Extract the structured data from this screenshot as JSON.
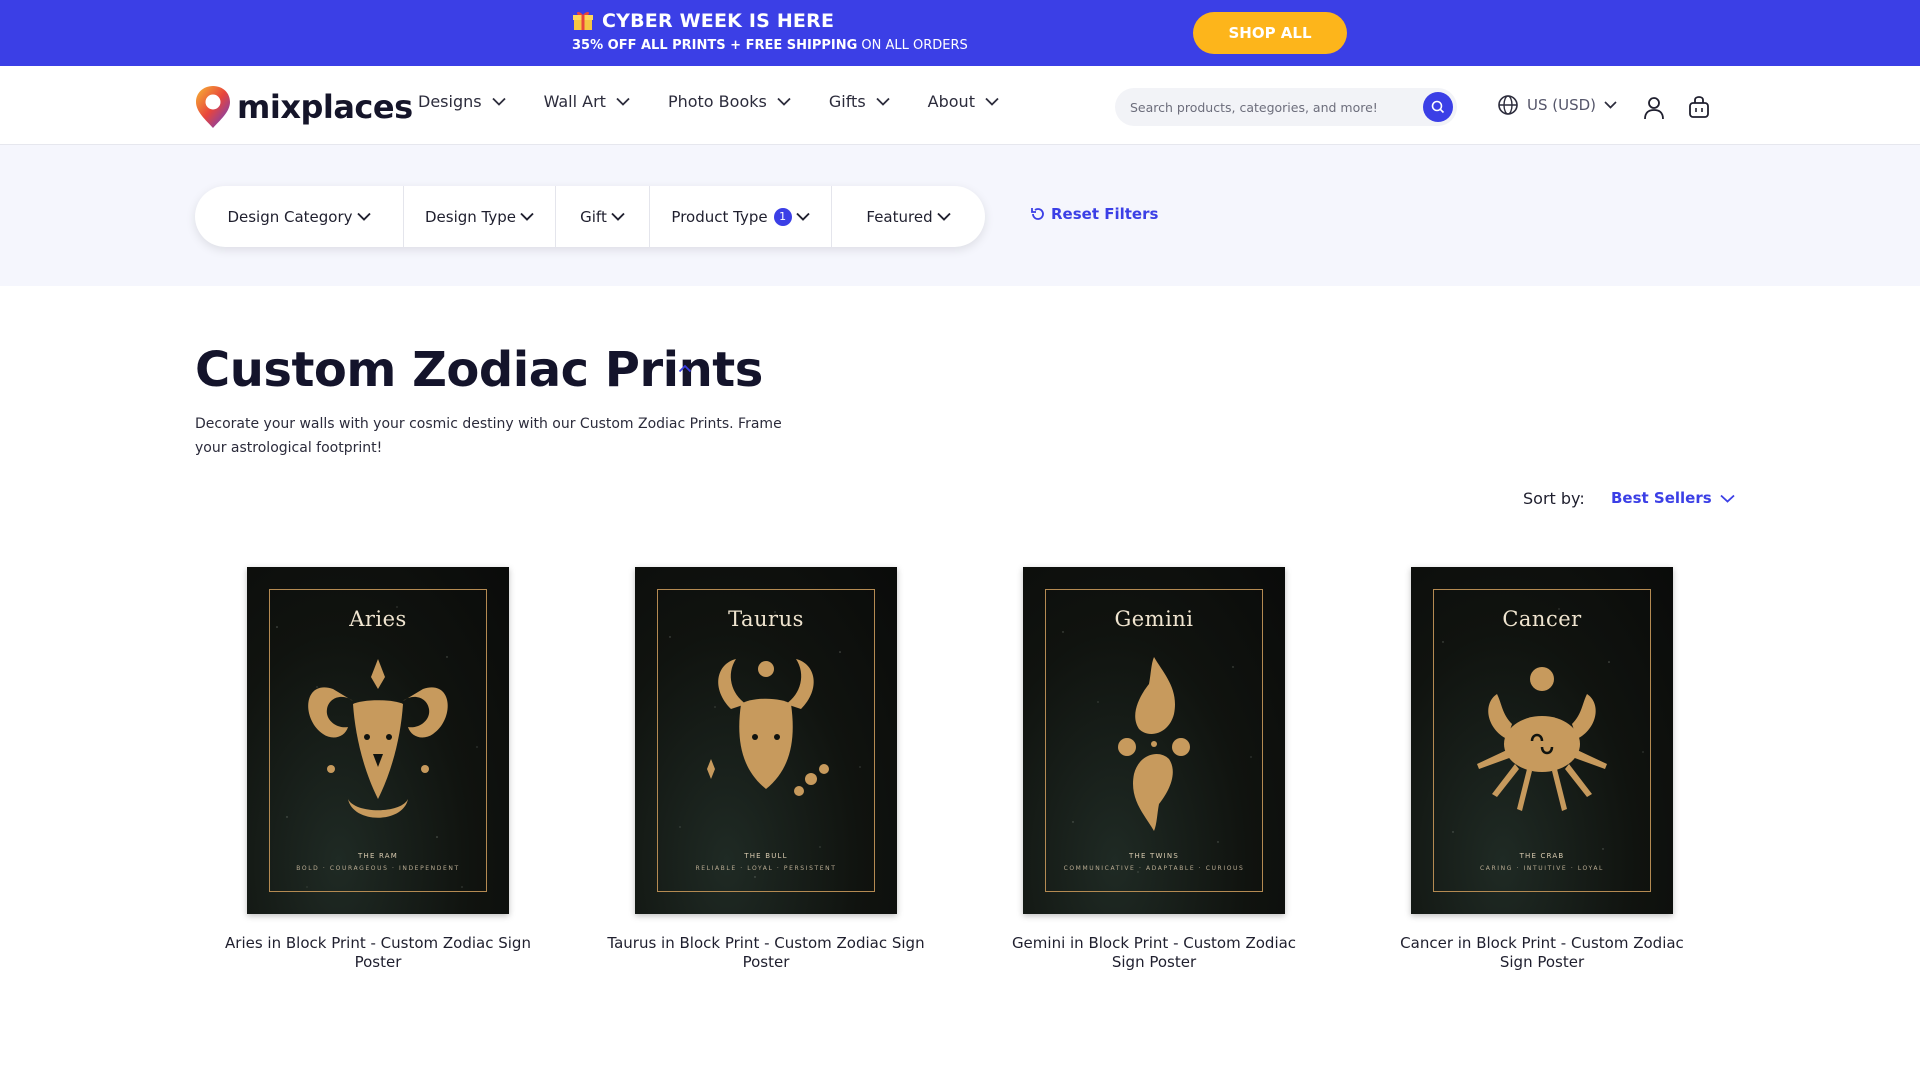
{
  "promo": {
    "title": "CYBER WEEK IS HERE",
    "sub_bold": "35% OFF ALL PRINTS + FREE SHIPPING",
    "sub_rest": " ON ALL ORDERS",
    "cta": "SHOP ALL",
    "icon": "gift-icon"
  },
  "header": {
    "logo_text": "mixplaces",
    "nav": [
      {
        "label": "Designs"
      },
      {
        "label": "Wall Art"
      },
      {
        "label": "Photo Books"
      },
      {
        "label": "Gifts"
      },
      {
        "label": "About"
      }
    ],
    "search_placeholder": "Search products, categories, and more!",
    "locale": "US (USD)"
  },
  "filters": {
    "items": [
      {
        "label": "Design Category"
      },
      {
        "label": "Design Type"
      },
      {
        "label": "Gift"
      },
      {
        "label": "Product Type",
        "count": "1"
      },
      {
        "label": "Featured"
      }
    ],
    "reset_label": "Reset Filters"
  },
  "page": {
    "title": "Custom Zodiac Prints",
    "description": "Decorate your walls with your cosmic destiny with our Custom Zodiac Prints. Frame your astrological footprint!"
  },
  "sort": {
    "label": "Sort by:",
    "value": "Best Sellers"
  },
  "colors": {
    "accent": "#3b3fe6",
    "cta": "#fdb51b",
    "gold": "#c79a5d",
    "poster_bg": "#10130f"
  },
  "products": [
    {
      "name": "Aries",
      "sub1": "THE RAM",
      "sub2": "BOLD · COURAGEOUS · INDEPENDENT",
      "title": "Aries in Block Print - Custom Zodiac Sign Poster"
    },
    {
      "name": "Taurus",
      "sub1": "THE BULL",
      "sub2": "RELIABLE · LOYAL · PERSISTENT",
      "title": "Taurus in Block Print - Custom Zodiac Sign Poster"
    },
    {
      "name": "Gemini",
      "sub1": "THE TWINS",
      "sub2": "COMMUNICATIVE · ADAPTABLE · CURIOUS",
      "title": "Gemini in Block Print - Custom Zodiac Sign Poster"
    },
    {
      "name": "Cancer",
      "sub1": "THE CRAB",
      "sub2": "CARING · INTUITIVE · LOYAL",
      "title": "Cancer in Block Print - Custom Zodiac Sign Poster"
    }
  ]
}
